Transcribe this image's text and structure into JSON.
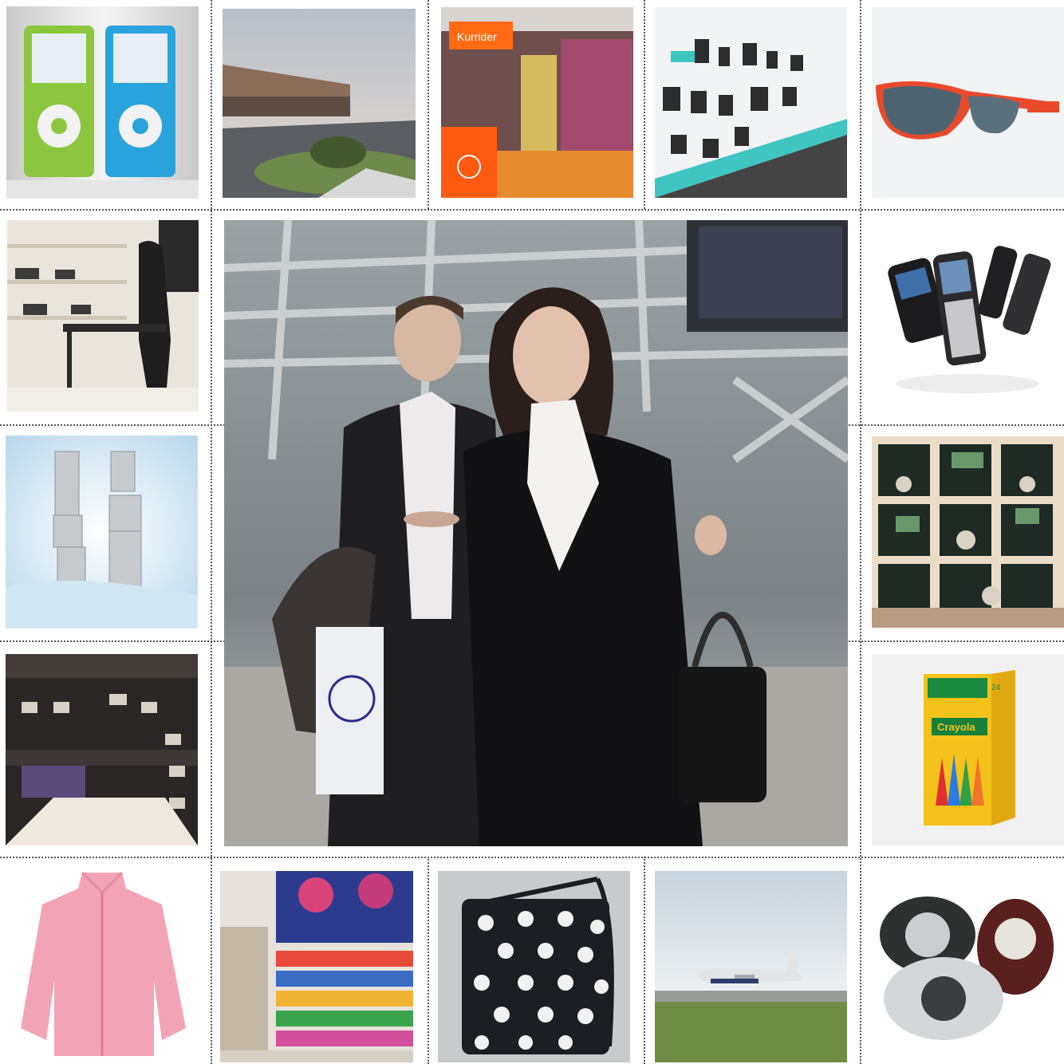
{
  "collage": {
    "shop_sign": "Kurrider",
    "crayon_box": {
      "top_label": "24",
      "brand": "Crayola"
    }
  },
  "colors": {
    "dotted_line": "#555555",
    "background": "#ffffff"
  },
  "icons": [
    "media-player-icon",
    "sunglasses-icon",
    "phone-icon",
    "watch-icon",
    "airplane-icon",
    "bag-icon",
    "jacket-icon"
  ]
}
